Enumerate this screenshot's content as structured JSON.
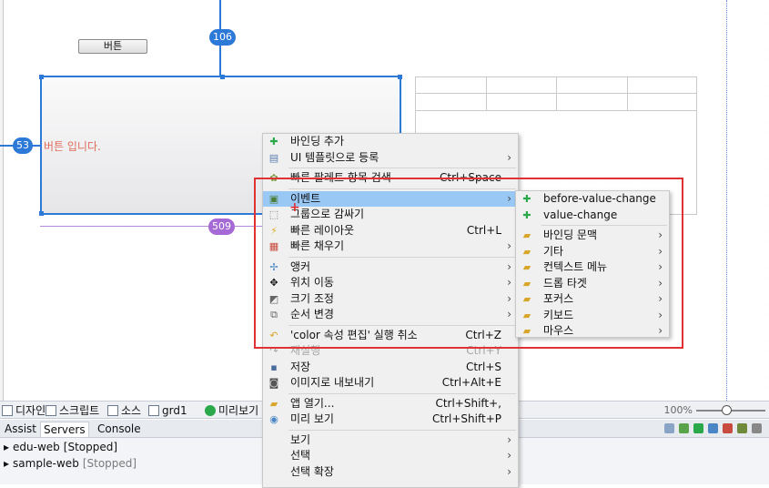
{
  "canvas": {
    "button_label": "버튼",
    "selected_text": "버튼 입니다.",
    "badge_top": "106",
    "badge_left": "53",
    "badge_width": "509"
  },
  "tabs": [
    {
      "label": "디자인"
    },
    {
      "label": "스크립트"
    },
    {
      "label": "소스"
    },
    {
      "label": "grd1"
    },
    {
      "label": "미리보기"
    }
  ],
  "zoom": "100%",
  "servers_panel": {
    "tabs": [
      {
        "label": "Assist"
      },
      {
        "label": "Servers"
      },
      {
        "label": "Console"
      }
    ],
    "rows": [
      {
        "name": "edu-web",
        "status": "[Stopped]"
      },
      {
        "name": "sample-web",
        "status": "[Stopped]"
      }
    ]
  },
  "context_menu": {
    "items": [
      {
        "label": "바인딩 추가",
        "shortcut": "",
        "icon": "plus-icon"
      },
      {
        "label": "UI 템플릿으로 등록",
        "shortcut": "",
        "icon": "template-icon"
      },
      {
        "label": "빠른 팔레트 항목 검색",
        "shortcut": "Ctrl+Space",
        "icon": "palette-icon"
      },
      {
        "label": "이벤트",
        "shortcut": "",
        "icon": "event-icon"
      },
      {
        "label": "그룹으로 감싸기",
        "shortcut": "",
        "icon": "group-icon"
      },
      {
        "label": "빠른 레이아웃",
        "shortcut": "Ctrl+L",
        "icon": "lightning-icon"
      },
      {
        "label": "빠른 채우기",
        "shortcut": "",
        "icon": "fill-icon"
      },
      {
        "label": "앵커",
        "shortcut": "",
        "icon": "anchor-icon"
      },
      {
        "label": "위치 이동",
        "shortcut": "",
        "icon": "move-icon"
      },
      {
        "label": "크기 조정",
        "shortcut": "",
        "icon": "resize-icon"
      },
      {
        "label": "순서 변경",
        "shortcut": "",
        "icon": "order-icon"
      },
      {
        "label": "'color 속성 편집' 실행 취소",
        "shortcut": "Ctrl+Z",
        "icon": "undo-icon"
      },
      {
        "label": "재실행",
        "shortcut": "Ctrl+Y",
        "icon": "redo-icon"
      },
      {
        "label": "저장",
        "shortcut": "Ctrl+S",
        "icon": "save-icon"
      },
      {
        "label": "이미지로 내보내기",
        "shortcut": "Ctrl+Alt+E",
        "icon": "camera-icon"
      },
      {
        "label": "앱 열기...",
        "shortcut": "Ctrl+Shift+,",
        "icon": "folder-icon"
      },
      {
        "label": "미리 보기",
        "shortcut": "Ctrl+Shift+P",
        "icon": "preview-icon"
      },
      {
        "label": "보기",
        "shortcut": "",
        "icon": ""
      },
      {
        "label": "선택",
        "shortcut": "",
        "icon": ""
      },
      {
        "label": "선택 확장",
        "shortcut": "",
        "icon": ""
      }
    ]
  },
  "submenu": {
    "items": [
      {
        "label": "before-value-change"
      },
      {
        "label": "value-change"
      },
      {
        "label": "바인딩 문맥"
      },
      {
        "label": "기타"
      },
      {
        "label": "컨텍스트 메뉴"
      },
      {
        "label": "드롭 타겟"
      },
      {
        "label": "포커스"
      },
      {
        "label": "키보드"
      },
      {
        "label": "마우스"
      }
    ]
  },
  "colors": {
    "accent": "#2d79d8",
    "highlight": "#99c8f5",
    "annotation": "#e03232"
  }
}
